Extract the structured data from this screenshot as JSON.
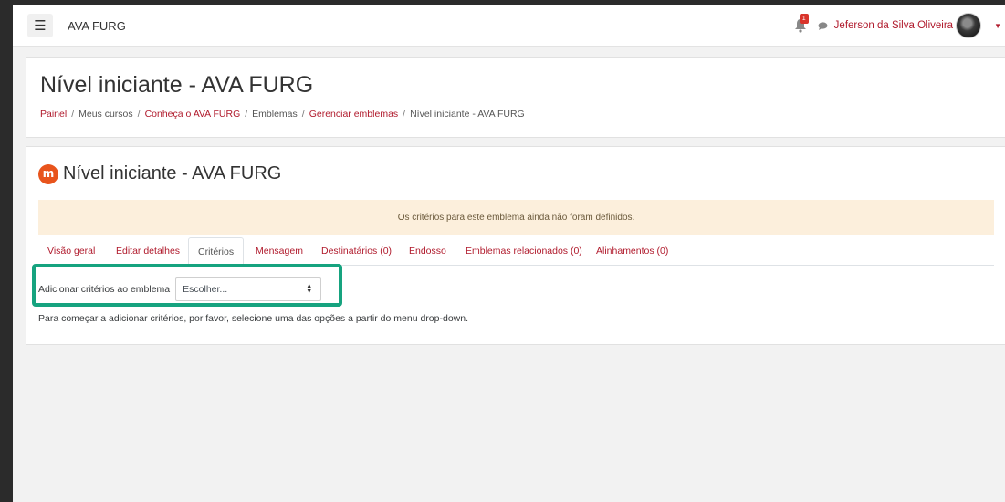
{
  "navbar": {
    "menu_icon": "hamburger-icon",
    "brand": "AVA FURG",
    "notifications_count": "1",
    "user_name": "Jeferson da Silva Oliveira"
  },
  "header": {
    "title": "Nível iniciante - AVA FURG",
    "breadcrumb": [
      {
        "label": "Painel",
        "link": true
      },
      {
        "label": "Meus cursos",
        "link": false
      },
      {
        "label": "Conheça o AVA FURG",
        "link": true
      },
      {
        "label": "Emblemas",
        "link": false
      },
      {
        "label": "Gerenciar emblemas",
        "link": true
      },
      {
        "label": "Nível iniciante - AVA FURG",
        "link": false
      }
    ]
  },
  "badge": {
    "logo_text": "m",
    "title": "Nível iniciante - AVA FURG",
    "alert": "Os critérios para este emblema ainda não foram definidos."
  },
  "tabs": [
    {
      "label": "Visão geral"
    },
    {
      "label": "Editar detalhes"
    },
    {
      "label": "Critérios",
      "active": true
    },
    {
      "label": "Mensagem"
    },
    {
      "label": "Destinatários (0)"
    },
    {
      "label": "Endosso"
    },
    {
      "label": "Emblemas relacionados (0)"
    },
    {
      "label": "Alinhamentos (0)"
    }
  ],
  "criteria": {
    "label": "Adicionar critérios ao emblema",
    "select_value": "Escolher...",
    "help": "Para começar a adicionar critérios, por favor, selecione uma das opções a partir do menu drop-down."
  },
  "colors": {
    "link": "#b01a2c",
    "highlight": "#16a37f",
    "alert_bg": "#fcefdc"
  }
}
